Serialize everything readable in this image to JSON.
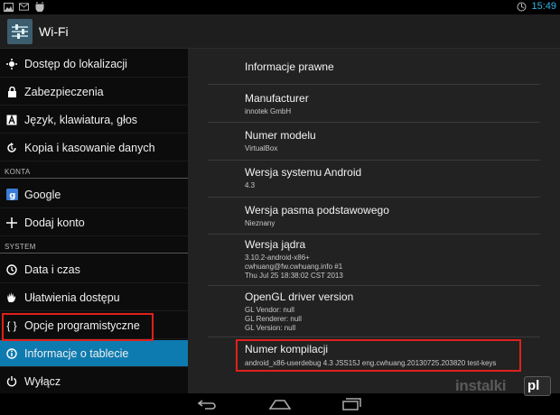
{
  "status_bar": {
    "time": "15:49",
    "left_icons": [
      "image-icon",
      "mail-icon",
      "usb-debug-icon"
    ],
    "right_icons": [
      "screen-lock-icon"
    ]
  },
  "action_bar": {
    "title": "Wi-Fi"
  },
  "sidebar": {
    "items": [
      {
        "label": "Dostęp do lokalizacji",
        "icon": "location-icon"
      },
      {
        "label": "Zabezpieczenia",
        "icon": "lock-icon"
      },
      {
        "label": "Język, klawiatura, głos",
        "icon": "language-icon"
      },
      {
        "label": "Kopia i kasowanie danych",
        "icon": "backup-icon"
      },
      {
        "label": "Google",
        "icon": "google-icon"
      },
      {
        "label": "Dodaj konto",
        "icon": "add-icon"
      },
      {
        "label": "Data i czas",
        "icon": "clock-icon"
      },
      {
        "label": "Ułatwienia dostępu",
        "icon": "accessibility-icon"
      },
      {
        "label": "Opcje programistyczne",
        "icon": "braces-icon"
      },
      {
        "label": "Informacje o tablecie",
        "icon": "info-icon"
      },
      {
        "label": "Wyłącz",
        "icon": "power-icon"
      }
    ],
    "headers": {
      "accounts": "KONTA",
      "system": "SYSTEM"
    },
    "active_item": "Informacje o tablecie"
  },
  "about": {
    "legal": {
      "title": "Informacje prawne"
    },
    "manufacturer": {
      "title": "Manufacturer",
      "value": "innotek GmbH"
    },
    "model": {
      "title": "Numer modelu",
      "value": "VirtualBox"
    },
    "android_version": {
      "title": "Wersja systemu Android",
      "value": "4.3"
    },
    "baseband": {
      "title": "Wersja pasma podstawowego",
      "value": "Nieznany"
    },
    "kernel": {
      "title": "Wersja jądra",
      "line1": "3.10.2-android-x86+",
      "line2": "cwhuang@fw.cwhuang.info #1",
      "line3": "Thu Jul 25 18:38:02 CST 2013"
    },
    "opengl": {
      "title": "OpenGL driver version",
      "line1": "GL Vendor: null",
      "line2": "GL Renderer: null",
      "line3": "GL Version: null"
    },
    "build": {
      "title": "Numer kompilacji",
      "value": "android_x86-userdebug 4.3 JSS15J eng.cwhuang.20130725.203820 test-keys"
    }
  },
  "colors": {
    "accent": "#0e7bb0",
    "highlight": "#e0201b",
    "clock": "#33b5e5"
  },
  "watermark": {
    "text": "instalki",
    "suffix": "pl"
  }
}
